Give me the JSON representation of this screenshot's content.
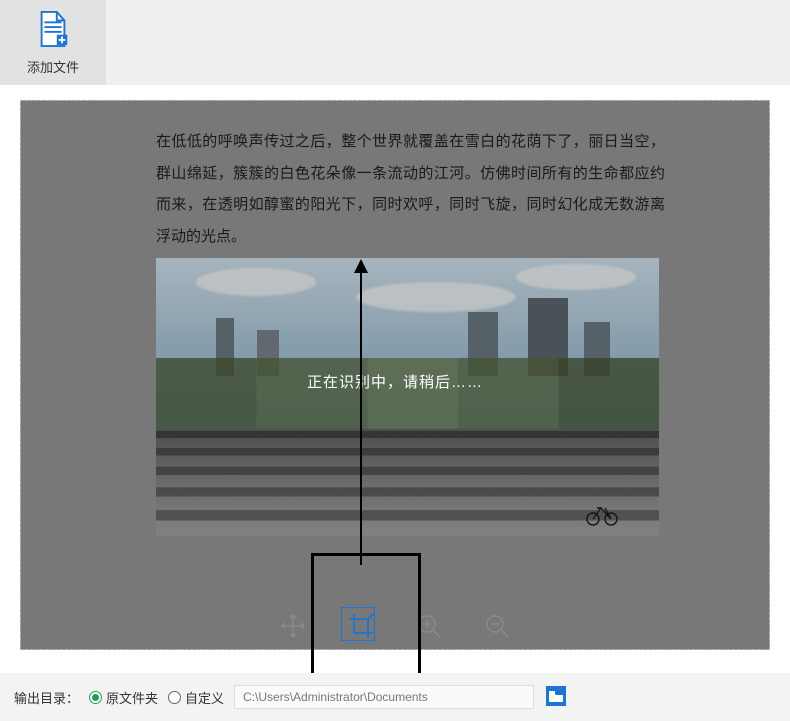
{
  "toolbar": {
    "add_file_label": "添加文件",
    "add_file_icon": "add-file-icon"
  },
  "document": {
    "paragraph": "在低低的呼唤声传过之后，整个世界就覆盖在雪白的花荫下了，丽日当空，群山绵延，簇簇的白色花朵像一条流动的江河。仿佛时间所有的生命都应约而来，在透明如醇蜜的阳光下，同时欢呼，同时飞旋，同时幻化成无数游离浮动的光点。",
    "image_alt": "cityscape-with-crosswalk"
  },
  "status": {
    "message": "正在识别中，请稍后……"
  },
  "controls": {
    "move_icon": "move-icon",
    "crop_icon": "crop-icon",
    "zoom_in_icon": "zoom-in-icon",
    "zoom_out_icon": "zoom-out-icon"
  },
  "footer": {
    "output_dir_label": "输出目录：",
    "option_source": "原文件夹",
    "option_custom": "自定义",
    "selected_option": "source",
    "path_value": "C:\\Users\\Administrator\\Documents",
    "browse_icon": "folder-icon"
  },
  "colors": {
    "accent_blue": "#1976d2",
    "accent_green": "#19a24c"
  }
}
